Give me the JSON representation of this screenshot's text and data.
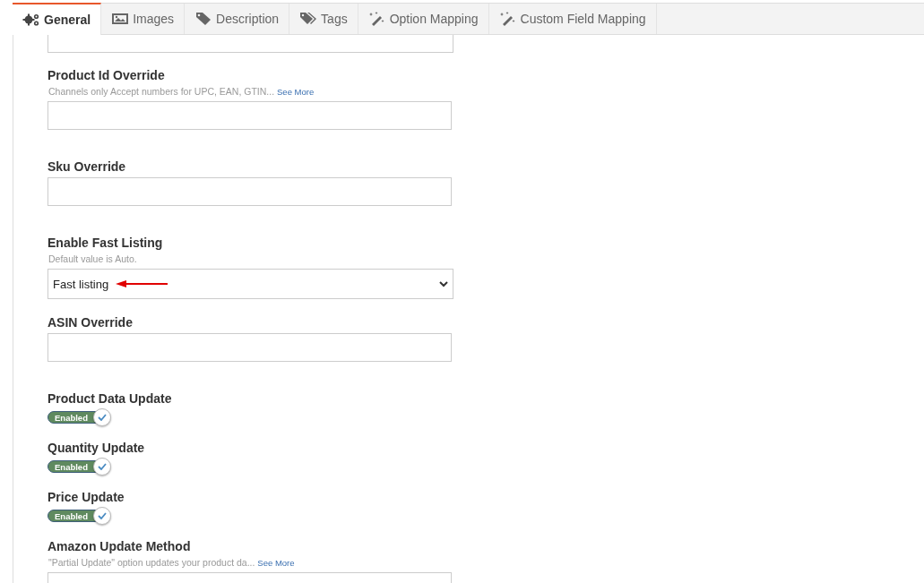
{
  "tabs": [
    {
      "label": "General",
      "selected": true
    },
    {
      "label": "Images",
      "selected": false
    },
    {
      "label": "Description",
      "selected": false
    },
    {
      "label": "Tags",
      "selected": false
    },
    {
      "label": "Option Mapping",
      "selected": false
    },
    {
      "label": "Custom Field Mapping",
      "selected": false
    }
  ],
  "fields": [
    {
      "kind": "stub"
    },
    {
      "kind": "text",
      "label": "Product Id Override",
      "hint": "Channels only Accept numbers for UPC, EAN, GTIN...",
      "hint_link": "See More"
    },
    {
      "kind": "text",
      "label": "Sku Override"
    },
    {
      "kind": "select",
      "label": "Enable Fast Listing",
      "hint": "Default value is Auto.",
      "value": "Fast listing",
      "annotated": true
    },
    {
      "kind": "text",
      "label": "ASIN Override"
    },
    {
      "kind": "toggle",
      "label": "Product Data Update",
      "toggle_label": "Enabled",
      "on": true
    },
    {
      "kind": "toggle",
      "label": "Quantity Update",
      "toggle_label": "Enabled",
      "on": true
    },
    {
      "kind": "toggle",
      "label": "Price Update",
      "toggle_label": "Enabled",
      "on": true
    },
    {
      "kind": "text",
      "label": "Amazon Update Method",
      "hint": "\"Partial Update\" option updates your product da...",
      "hint_link": "See More"
    }
  ]
}
